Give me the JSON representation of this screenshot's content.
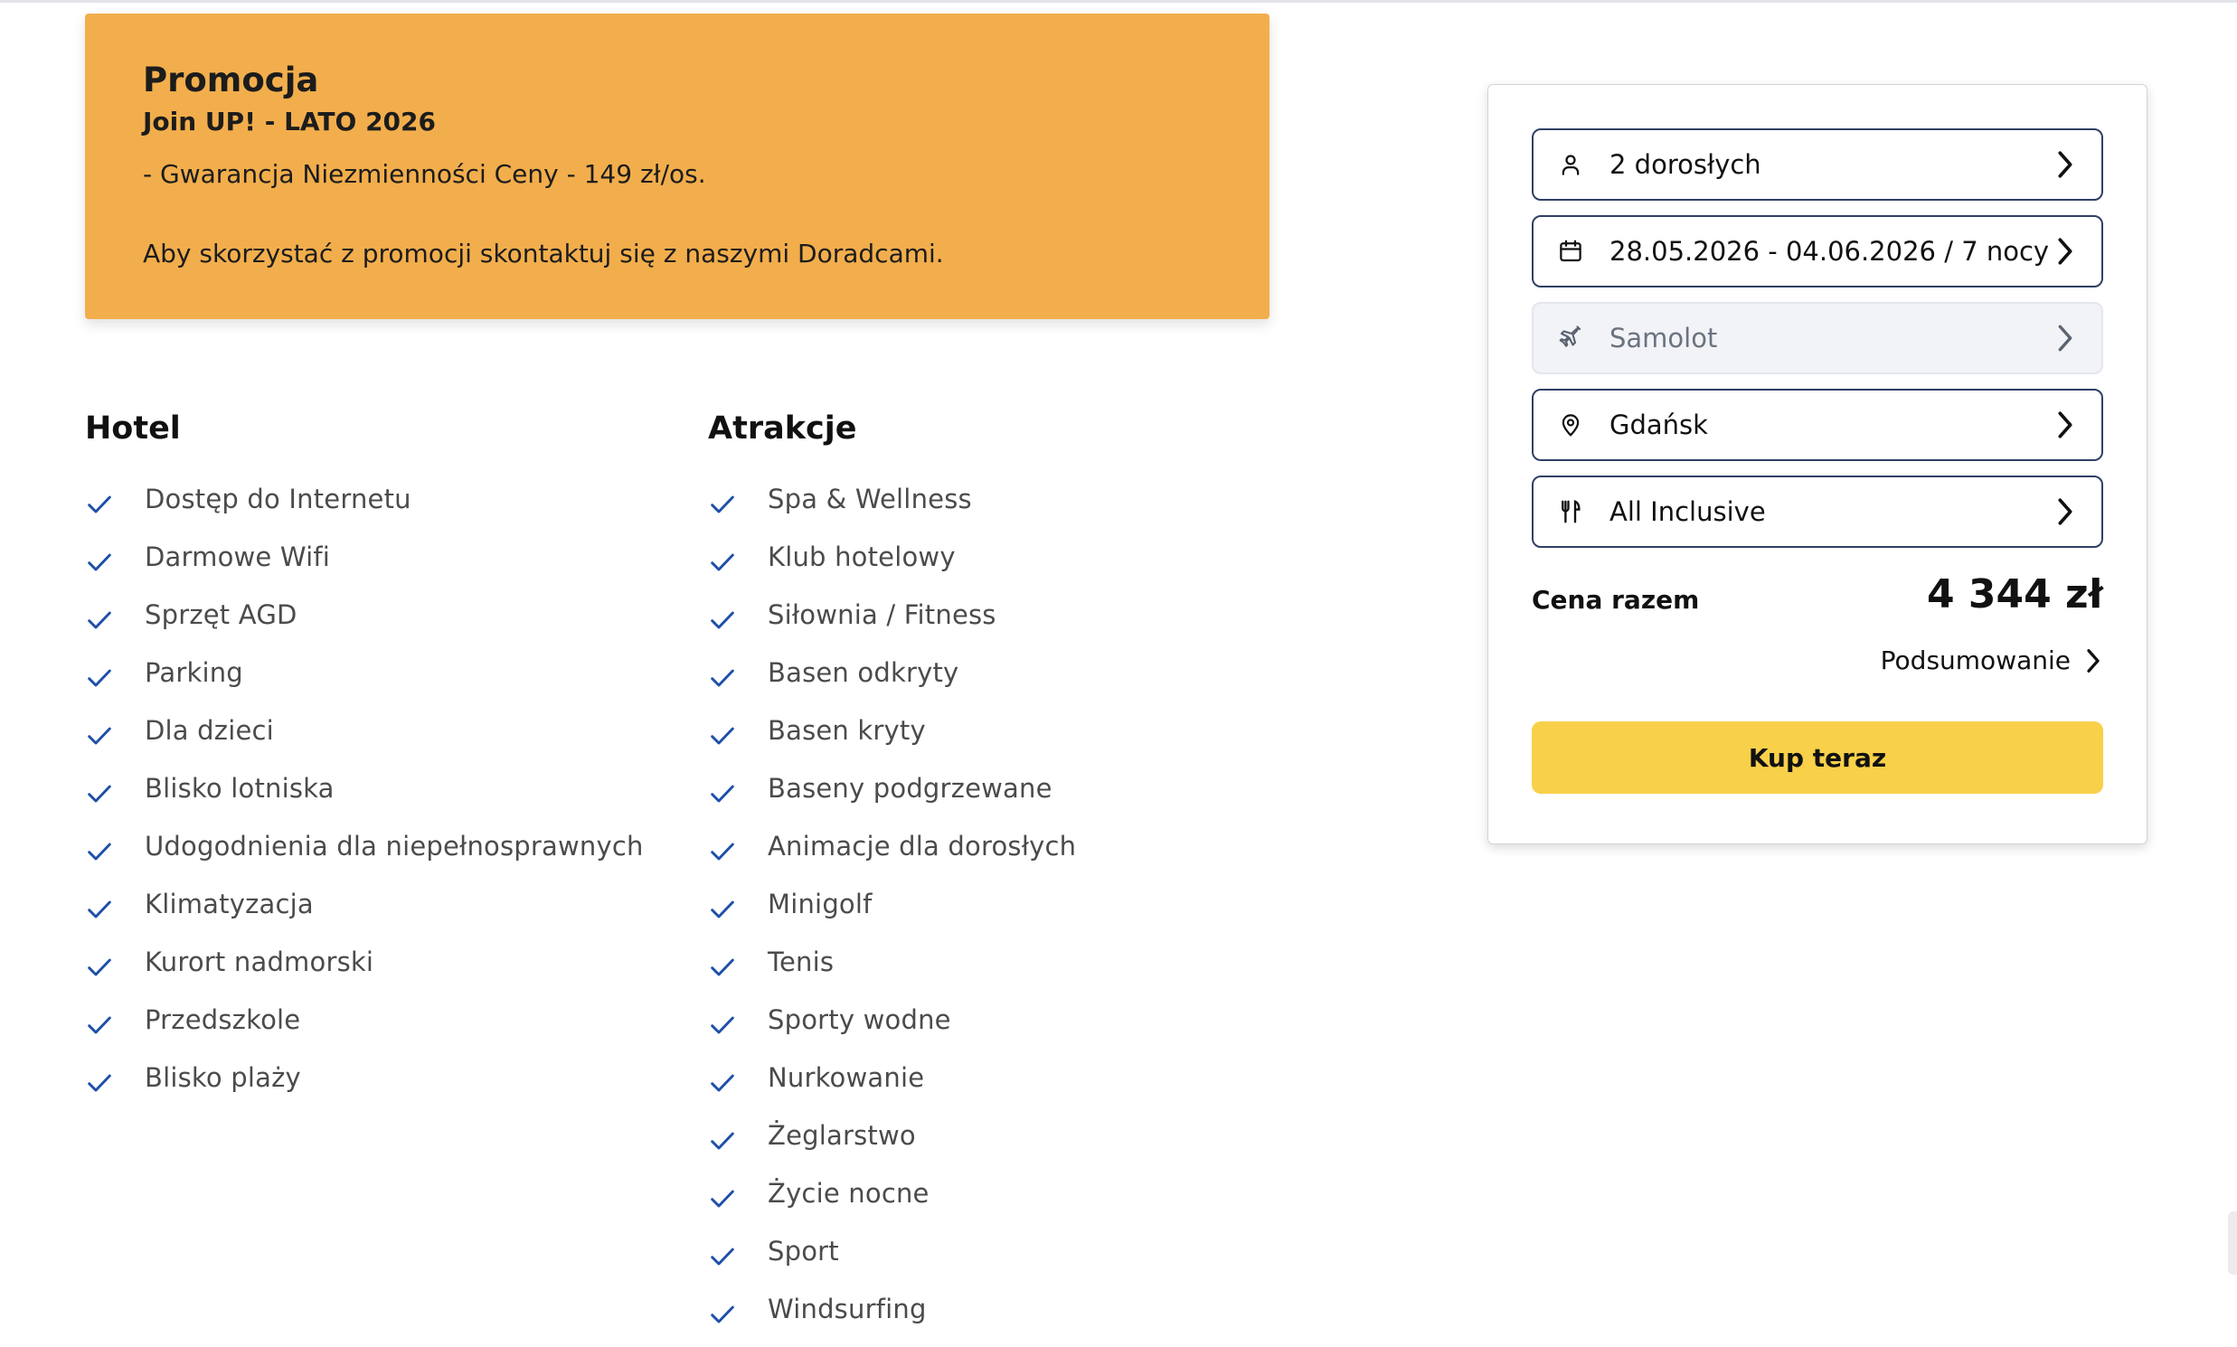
{
  "promo": {
    "title": "Promocja",
    "subtitle": "Join UP! - LATO 2026",
    "line": "- Gwarancja Niezmienności Ceny - 149 zł/os.",
    "note": "Aby skorzystać z promocji skontaktuj się z naszymi Doradcami.",
    "background_color": "#f2ae4c"
  },
  "hotel": {
    "heading": "Hotel",
    "items": [
      "Dostęp do Internetu",
      "Darmowe Wifi",
      "Sprzęt AGD",
      "Parking",
      "Dla dzieci",
      "Blisko lotniska",
      "Udogodnienia dla niepełnosprawnych",
      "Klimatyzacja",
      "Kurort nadmorski",
      "Przedszkole",
      "Blisko plaży"
    ]
  },
  "attractions": {
    "heading": "Atrakcje",
    "items": [
      "Spa & Wellness",
      "Klub hotelowy",
      "Siłownia / Fitness",
      "Basen odkryty",
      "Basen kryty",
      "Baseny podgrzewane",
      "Animacje dla dorosłych",
      "Minigolf",
      "Tenis",
      "Sporty wodne",
      "Nurkowanie",
      "Żeglarstwo",
      "Życie nocne",
      "Sport",
      "Windsurfing"
    ]
  },
  "check_icon_color": "#1e4fa8",
  "booking": {
    "travelers": {
      "label": "2 dorosłych",
      "icon": "person-icon"
    },
    "dates": {
      "label": "28.05.2026 - 04.06.2026 / 7 nocy",
      "icon": "calendar-icon"
    },
    "transport": {
      "label": "Samolot",
      "icon": "plane-icon",
      "disabled": true
    },
    "departure": {
      "label": "Gdańsk",
      "icon": "location-pin-icon"
    },
    "board": {
      "label": "All Inclusive",
      "icon": "cutlery-icon"
    },
    "total_label": "Cena razem",
    "total_value": "4 344 zł",
    "summary_label": "Podsumowanie",
    "buy_label": "Kup teraz",
    "buy_color": "#f8d04a",
    "border_color": "#2f3f66"
  }
}
